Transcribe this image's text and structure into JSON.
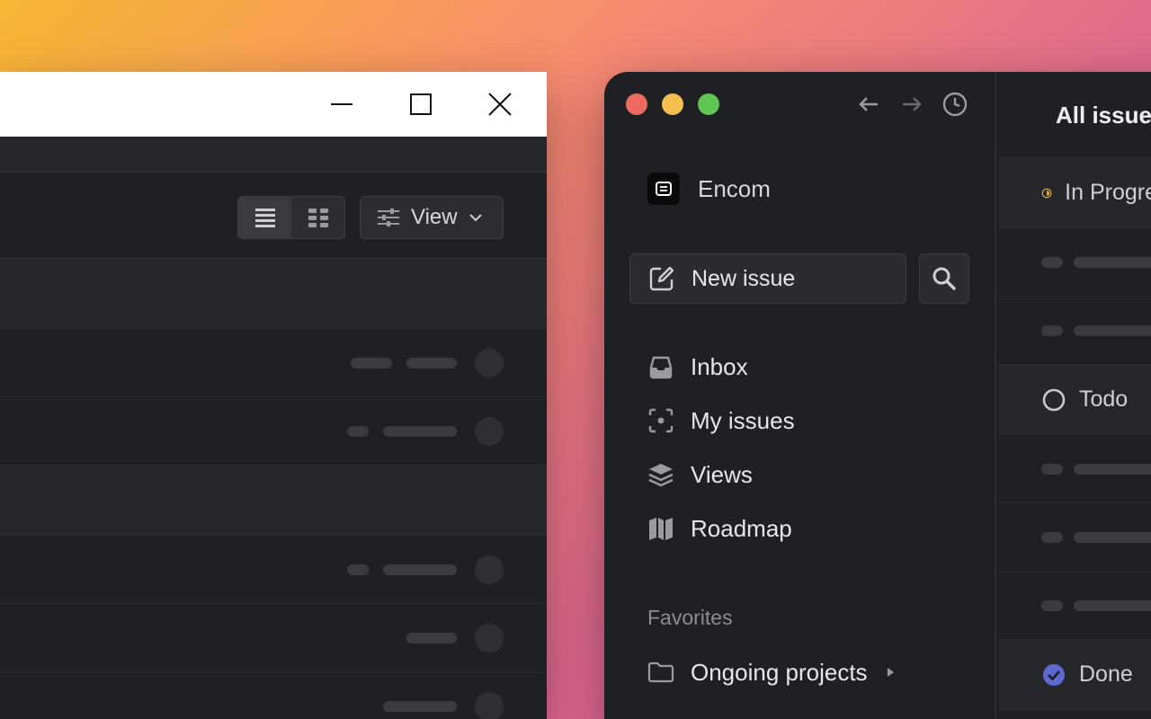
{
  "left_window": {
    "view_label": "View",
    "icons": {
      "minimize": "minimize-icon",
      "maximize": "maximize-icon",
      "close": "close-icon",
      "list": "list-view-icon",
      "grid": "grid-view-icon",
      "filter": "sliders-icon",
      "chevron": "chevron-down-icon"
    }
  },
  "right_window": {
    "workspace": {
      "name": "Encom"
    },
    "new_issue_label": "New issue",
    "nav": [
      {
        "label": "Inbox",
        "icon": "inbox-icon"
      },
      {
        "label": "My issues",
        "icon": "my-issues-icon"
      },
      {
        "label": "Views",
        "icon": "layers-icon"
      },
      {
        "label": "Roadmap",
        "icon": "map-icon"
      }
    ],
    "favorites_label": "Favorites",
    "favorites": [
      {
        "label": "Ongoing projects",
        "icon": "folder-icon"
      }
    ],
    "main": {
      "title": "All issues",
      "groups": [
        {
          "label": "In Progress",
          "color": "#e2b340"
        },
        {
          "label": "Todo",
          "color": "#c9cace"
        },
        {
          "label": "Done",
          "color": "#5e6ad2"
        }
      ]
    },
    "colors": {
      "traffic_close": "#ec6a5e",
      "traffic_min": "#f4bf4f",
      "traffic_max": "#61c554"
    }
  }
}
